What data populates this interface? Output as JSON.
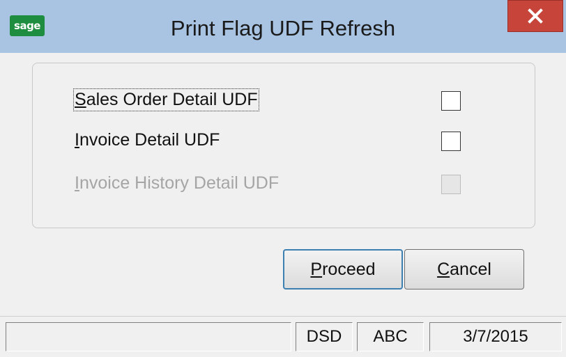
{
  "window": {
    "title": "Print Flag UDF Refresh",
    "logo_text": "sage",
    "close_glyph": "×",
    "close_icon": "close-icon"
  },
  "options": [
    {
      "label_first": "S",
      "label_rest": "ales Order Detail UDF",
      "checked": false,
      "enabled": true,
      "focused": true
    },
    {
      "label_first": "I",
      "label_rest": "nvoice Detail UDF",
      "checked": false,
      "enabled": true,
      "focused": false
    },
    {
      "label_first": "I",
      "label_rest": "nvoice History Detail UDF",
      "checked": false,
      "enabled": false,
      "focused": false
    }
  ],
  "buttons": {
    "proceed": {
      "accel": "P",
      "rest": "roceed"
    },
    "cancel": {
      "accel": "C",
      "rest": "ancel"
    }
  },
  "status": {
    "message": "",
    "company_code": "DSD",
    "company": "ABC",
    "date": "3/7/2015"
  },
  "colors": {
    "titlebar": "#a9c4e3",
    "close": "#c7443a",
    "logo": "#1f8d3f",
    "disabled_text": "#a5a5a5"
  }
}
